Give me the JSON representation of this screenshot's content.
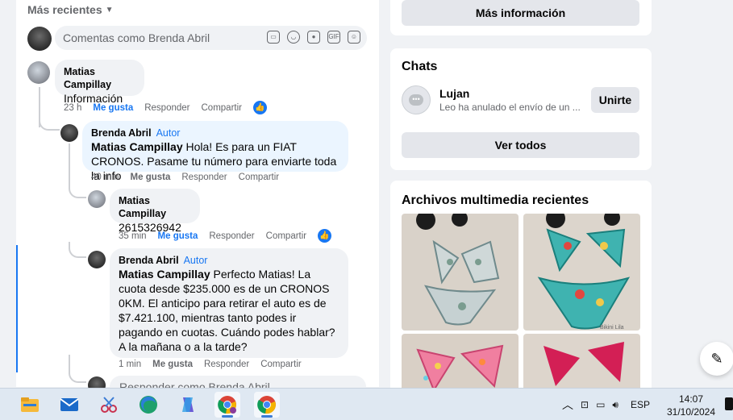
{
  "feed": {
    "sort_label": "Más recientes",
    "comment_placeholder": "Comentas como Brenda Abril",
    "reply_placeholder": "Responder como Brenda Abril",
    "comments": [
      {
        "name": "Matias Campillay",
        "text": "Información",
        "time": "23 h",
        "like": "Me gusta",
        "reply": "Responder",
        "share": "Compartir"
      },
      {
        "name": "Brenda Abril",
        "author_badge": "Autor",
        "mention": "Matias Campillay",
        "text": " Hola! Es para un FIAT CRONOS. Pasame tu número para enviarte toda la info",
        "time": "40 min",
        "like": "Me gusta",
        "reply": "Responder",
        "share": "Compartir"
      },
      {
        "name": "Matias Campillay",
        "text": "2615326942",
        "time": "35 min",
        "like": "Me gusta",
        "reply": "Responder",
        "share": "Compartir"
      },
      {
        "name": "Brenda Abril",
        "author_badge": "Autor",
        "mention": "Matias Campillay",
        "text": " Perfecto Matias! La cuota desde $235.000 es de un CRONOS 0KM. El anticipo para retirar el auto es de $7.421.100, mientras tanto podes ir pagando en cuotas. Cuándo podes hablar? A la mañana o a la tarde?",
        "time": "1 min",
        "like": "Me gusta",
        "reply": "Responder",
        "share": "Compartir"
      }
    ]
  },
  "right": {
    "more_info_button": "Más información",
    "chats_title": "Chats",
    "chat": {
      "name": "Lujan",
      "preview": "Leo ha anulado el envío de un ...",
      "join_button": "Unirte"
    },
    "see_all_button": "Ver todos",
    "media_title": "Archivos multimedia recientes",
    "media_watermark": "Bikini Lila"
  },
  "taskbar": {
    "language": "ESP",
    "time": "14:07",
    "date": "31/10/2024"
  },
  "colors": {
    "accent": "#1877f2",
    "bubble": "#f0f2f5",
    "bubble_active": "#ebf5ff"
  }
}
